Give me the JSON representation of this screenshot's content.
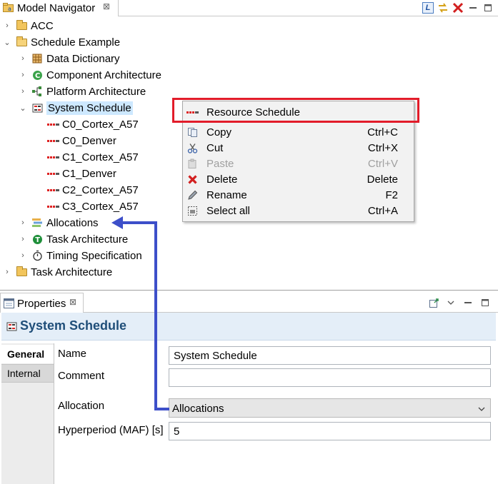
{
  "navigator": {
    "title": "Model Navigator",
    "close": "⊠",
    "toolbar": {
      "l_icon": "L"
    },
    "tree": [
      {
        "label": "ACC",
        "icon": "folder-icon",
        "expanded": false
      },
      {
        "label": "Schedule Example",
        "icon": "folder-open-icon",
        "expanded": true
      },
      {
        "label": "Data Dictionary",
        "icon": "data-dictionary-icon"
      },
      {
        "label": "Component Architecture",
        "icon": "component-architecture-icon"
      },
      {
        "label": "Platform Architecture",
        "icon": "platform-architecture-icon"
      },
      {
        "label": "System Schedule",
        "icon": "system-schedule-icon",
        "expanded": true,
        "selected": true
      },
      {
        "label": "C0_Cortex_A57",
        "icon": "resource-schedule-icon"
      },
      {
        "label": "C0_Denver",
        "icon": "resource-schedule-icon"
      },
      {
        "label": "C1_Cortex_A57",
        "icon": "resource-schedule-icon"
      },
      {
        "label": "C1_Denver",
        "icon": "resource-schedule-icon"
      },
      {
        "label": "C2_Cortex_A57",
        "icon": "resource-schedule-icon"
      },
      {
        "label": "C3_Cortex_A57",
        "icon": "resource-schedule-icon"
      },
      {
        "label": "Allocations",
        "icon": "allocations-icon"
      },
      {
        "label": "Task Architecture",
        "icon": "task-architecture-icon"
      },
      {
        "label": "Timing Specification",
        "icon": "timing-specification-icon"
      },
      {
        "label": "Task Architecture",
        "icon": "folder-icon"
      }
    ]
  },
  "context_menu": {
    "items": [
      {
        "label": "Resource Schedule",
        "shortcut": "",
        "icon": "resource-schedule-icon",
        "enabled": true
      },
      {
        "label": "Copy",
        "shortcut": "Ctrl+C",
        "icon": "copy-icon",
        "enabled": true
      },
      {
        "label": "Cut",
        "shortcut": "Ctrl+X",
        "icon": "cut-icon",
        "enabled": true
      },
      {
        "label": "Paste",
        "shortcut": "Ctrl+V",
        "icon": "paste-icon",
        "enabled": false
      },
      {
        "label": "Delete",
        "shortcut": "Delete",
        "icon": "delete-icon",
        "enabled": true
      },
      {
        "label": "Rename",
        "shortcut": "F2",
        "icon": "rename-icon",
        "enabled": true
      },
      {
        "label": "Select all",
        "shortcut": "Ctrl+A",
        "icon": "select-all-icon",
        "enabled": true
      }
    ],
    "highlight_color": "#e21c2a"
  },
  "properties": {
    "title": "Properties",
    "close": "⊠",
    "header_title": "System Schedule",
    "tabs": [
      {
        "label": "General",
        "active": true
      },
      {
        "label": "Internal",
        "active": false
      }
    ],
    "fields": {
      "name_label": "Name",
      "name_value": "System Schedule",
      "comment_label": "Comment",
      "comment_value": "",
      "allocation_label": "Allocation",
      "allocation_value": "Allocations",
      "hyperperiod_label": "Hyperperiod (MAF) [s]",
      "hyperperiod_value": "5"
    }
  },
  "annotation": {
    "arrow_color": "#3d4fc9"
  }
}
